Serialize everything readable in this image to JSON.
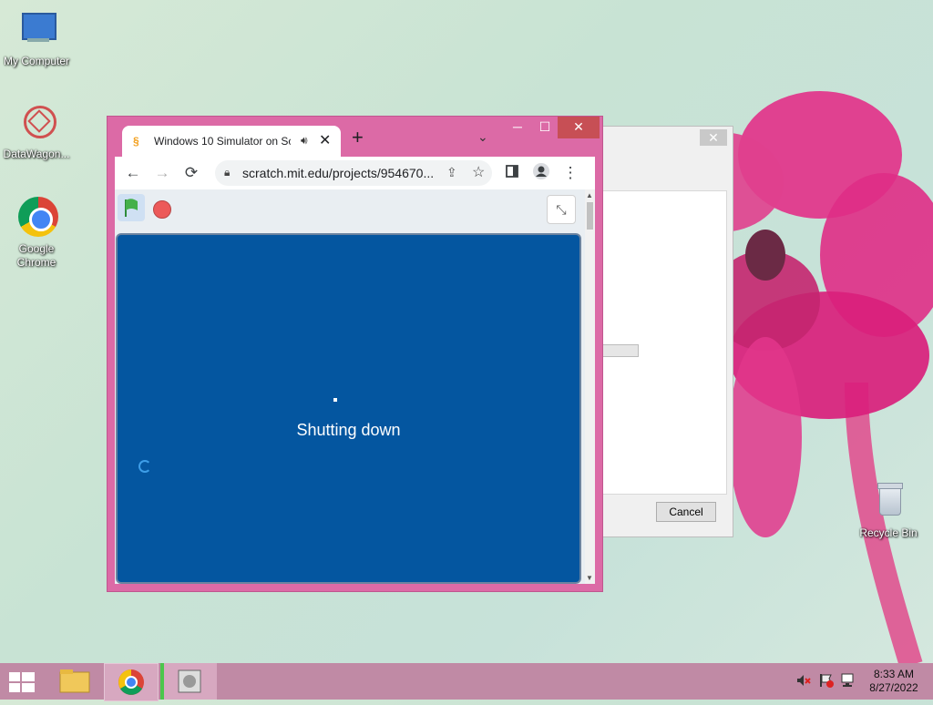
{
  "desktop": {
    "icons": [
      {
        "label": "My Computer"
      },
      {
        "label": "DataWagon..."
      },
      {
        "label": "Google Chrome"
      },
      {
        "label": "Recycle Bin"
      }
    ]
  },
  "bg_dialog": {
    "close_glyph": "✕",
    "cancel_label": "Cancel"
  },
  "browser": {
    "tab_title": "Windows 10 Simulator on Sc",
    "tab_close": "✕",
    "new_tab": "+",
    "tab_menu": "⌄",
    "win_min": "─",
    "win_max": "☐",
    "win_close": "✕",
    "back": "←",
    "forward": "→",
    "reload": "⟳",
    "url": "scratch.mit.edu/projects/954670...",
    "star": "☆",
    "menu": "⋮",
    "icons": {
      "favicon": "scratch-cat-icon",
      "audio": "speaker-icon",
      "lock": "lock-icon",
      "share": "share-icon",
      "side_panel": "side-panel-icon",
      "profile": "profile-icon"
    }
  },
  "scratch": {
    "stage_message": "Shutting down",
    "stage_color": "#0456a0",
    "flag_icon": "green-flag-icon",
    "stop_icon": "stop-icon",
    "shrink_glyph": "⤡"
  },
  "taskbar": {
    "time": "8:33 AM",
    "date": "8/27/2022",
    "apps": [
      "start-button",
      "file-explorer",
      "google-chrome",
      "active-app"
    ]
  }
}
